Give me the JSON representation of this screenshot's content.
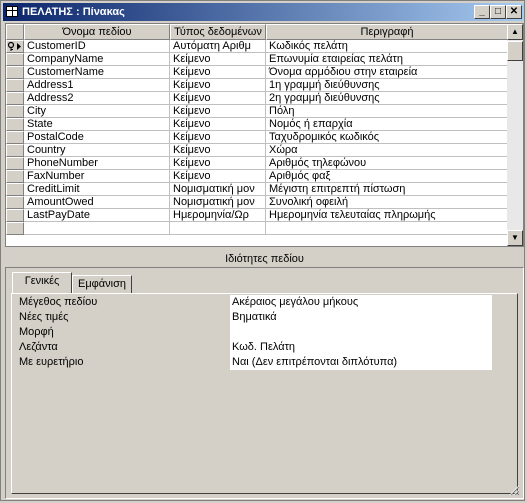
{
  "window": {
    "title": "ΠΕΛΑΤΗΣ : Πίνακας",
    "icon": "table-icon",
    "buttons": {
      "minimize": "_",
      "maximize": "□",
      "close": "✕"
    }
  },
  "grid": {
    "columns": [
      "Όνομα πεδίου",
      "Τύπος δεδομένων",
      "Περιγραφή"
    ],
    "rows": [
      {
        "name": "CustomerID",
        "type": "Αυτόματη Αριθμ",
        "desc": "Κωδικός πελάτη",
        "key": true
      },
      {
        "name": "CompanyName",
        "type": "Κείμενο",
        "desc": "Επωνυμία εταιρείας πελάτη"
      },
      {
        "name": "CustomerName",
        "type": "Κείμενο",
        "desc": "Όνομα αρμόδιου στην εταιρεία"
      },
      {
        "name": "Address1",
        "type": "Κείμενο",
        "desc": "1η γραμμή διεύθυνσης"
      },
      {
        "name": "Address2",
        "type": "Κείμενο",
        "desc": "2η γραμμή διεύθυνσης"
      },
      {
        "name": "City",
        "type": "Κείμενο",
        "desc": "Πόλη"
      },
      {
        "name": "State",
        "type": "Κείμενο",
        "desc": "Νομός ή επαρχία"
      },
      {
        "name": "PostalCode",
        "type": "Κείμενο",
        "desc": "Ταχυδρομικός κωδικός"
      },
      {
        "name": "Country",
        "type": "Κείμενο",
        "desc": "Χώρα"
      },
      {
        "name": "PhoneNumber",
        "type": "Κείμενο",
        "desc": "Αριθμός τηλεφώνου"
      },
      {
        "name": "FaxNumber",
        "type": "Κείμενο",
        "desc": "Αριθμός φαξ"
      },
      {
        "name": "CreditLimit",
        "type": "Νομισματική μον",
        "desc": "Μέγιστη επιτρεπτή πίστωση"
      },
      {
        "name": "AmountOwed",
        "type": "Νομισματική μον",
        "desc": "Συνολική οφειλή"
      },
      {
        "name": "LastPayDate",
        "type": "Ημερομηνία/Ωρ",
        "desc": "Ημερομηνία τελευταίας πληρωμής"
      },
      {
        "name": "",
        "type": "",
        "desc": ""
      }
    ]
  },
  "properties": {
    "section_title": "Ιδιότητες πεδίου",
    "tabs": [
      "Γενικές",
      "Εμφάνιση"
    ],
    "active_tab": "Γενικές",
    "items": [
      {
        "label": "Μέγεθος πεδίου",
        "value": "Ακέραιος μεγάλου μήκους"
      },
      {
        "label": "Νέες τιμές",
        "value": "Βηματικά"
      },
      {
        "label": "Μορφή",
        "value": ""
      },
      {
        "label": "Λεζάντα",
        "value": "Κωδ. Πελάτη"
      },
      {
        "label": "Με ευρετήριο",
        "value": "Ναι (Δεν επιτρέπονται διπλότυπα)"
      }
    ]
  }
}
